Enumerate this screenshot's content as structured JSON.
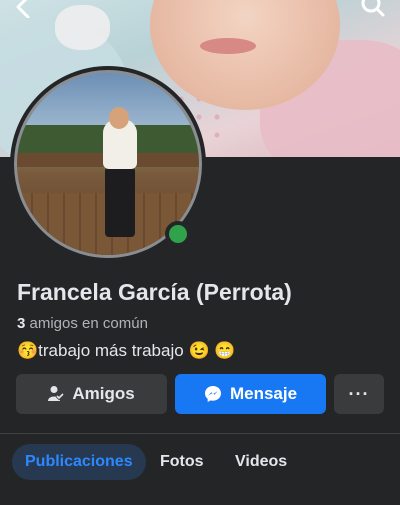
{
  "header": {
    "back_icon": "chevron-left-icon",
    "search_icon": "search-icon"
  },
  "profile": {
    "name": "Francela García (Perrota)",
    "mutual_count": "3",
    "mutual_label": "amigos en común",
    "bio_emoji_start": "😚",
    "bio_text": "trabajo más trabajo",
    "bio_emoji_end": "😉 😁",
    "online_status_color": "#31a24c"
  },
  "actions": {
    "friends_label": "Amigos",
    "message_label": "Mensaje",
    "more_label": "···"
  },
  "tabs": [
    {
      "label": "Publicaciones",
      "active": true
    },
    {
      "label": "Fotos",
      "active": false
    },
    {
      "label": "Videos",
      "active": false
    }
  ],
  "colors": {
    "background": "#242526",
    "accent": "#1877f2",
    "active_tab_bg": "#263951",
    "active_tab_text": "#2d88ff"
  }
}
